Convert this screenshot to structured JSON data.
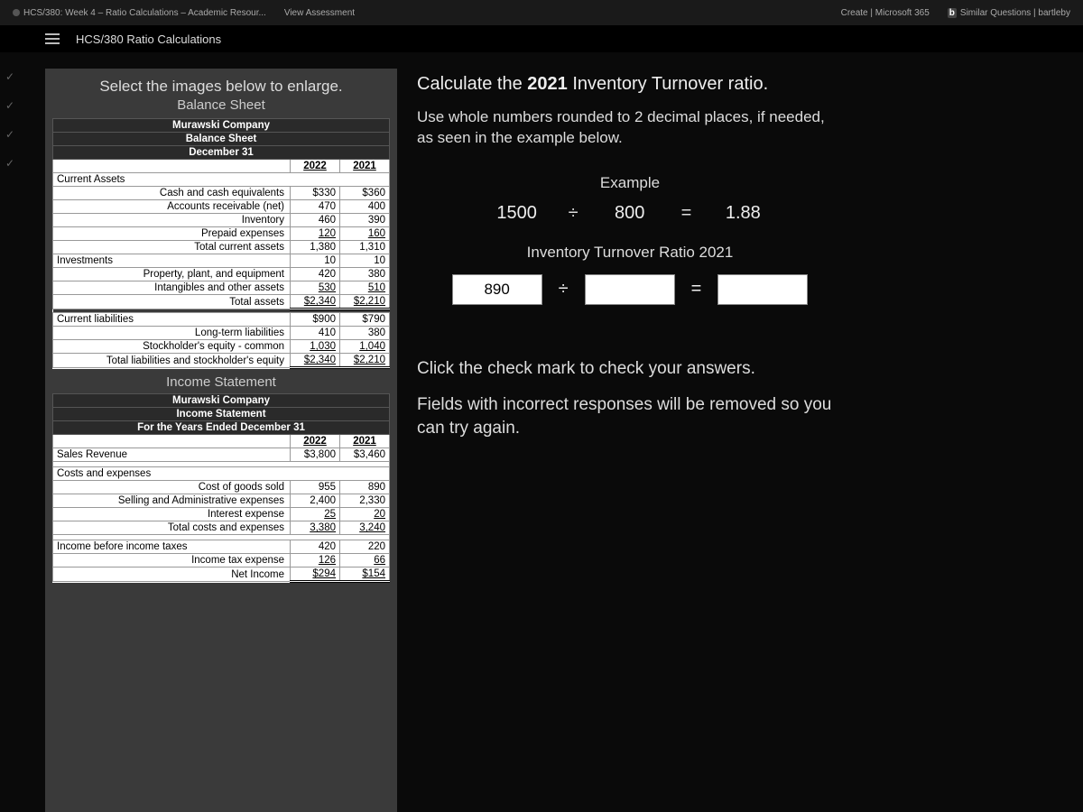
{
  "browser_tabs": {
    "t1": "HCS/380: Week 4 – Ratio Calculations – Academic Resour...",
    "t2": "View Assessment",
    "t3": "Create | Microsoft 365",
    "t4": "Similar Questions | bartleby"
  },
  "page_title": "HCS/380 Ratio Calculations",
  "left_panel": {
    "intro_line_1": "Select the images below to enlarge.",
    "balance_sheet_title": "Balance Sheet",
    "income_stmt_title": "Income Statement"
  },
  "balance_sheet": {
    "company": "Murawski Company",
    "report": "Balance Sheet",
    "asof": "December 31",
    "col_2022": "2022",
    "col_2021": "2021",
    "current_assets_label": "Current Assets",
    "rows_current": [
      {
        "label": "Cash and cash equivalents",
        "v2022": "$330",
        "v2021": "$360"
      },
      {
        "label": "Accounts receivable (net)",
        "v2022": "470",
        "v2021": "400"
      },
      {
        "label": "Inventory",
        "v2022": "460",
        "v2021": "390"
      },
      {
        "label": "Prepaid expenses",
        "v2022": "120",
        "v2021": "160",
        "u": true
      },
      {
        "label": "Total current assets",
        "v2022": "1,380",
        "v2021": "1,310"
      }
    ],
    "investments_label": "Investments",
    "investments_2022": "10",
    "investments_2021": "10",
    "rows_inv": [
      {
        "label": "Property, plant, and equipment",
        "v2022": "420",
        "v2021": "380"
      },
      {
        "label": "Intangibles and other assets",
        "v2022": "530",
        "v2021": "510",
        "u": true
      },
      {
        "label": "Total assets",
        "v2022": "$2,340",
        "v2021": "$2,210",
        "d": true
      }
    ],
    "current_liab_label": "Current liabilities",
    "current_liab_2022": "$900",
    "current_liab_2021": "$790",
    "rows_liab": [
      {
        "label": "Long-term liabilities",
        "v2022": "410",
        "v2021": "380"
      },
      {
        "label": "Stockholder's equity - common",
        "v2022": "1,030",
        "v2021": "1,040",
        "u": true
      },
      {
        "label": "Total liabilities and stockholder's equity",
        "v2022": "$2,340",
        "v2021": "$2,210",
        "d": true
      }
    ]
  },
  "income_statement": {
    "company": "Murawski Company",
    "report": "Income Statement",
    "period": "For the Years Ended December 31",
    "col_2022": "2022",
    "col_2021": "2021",
    "sales_label": "Sales Revenue",
    "sales_2022": "$3,800",
    "sales_2021": "$3,460",
    "costs_label": "Costs and expenses",
    "rows_costs": [
      {
        "label": "Cost of goods sold",
        "v2022": "955",
        "v2021": "890"
      },
      {
        "label": "Selling and Administrative expenses",
        "v2022": "2,400",
        "v2021": "2,330"
      },
      {
        "label": "Interest expense",
        "v2022": "25",
        "v2021": "20",
        "u": true
      },
      {
        "label": "Total costs and expenses",
        "v2022": "3,380",
        "v2021": "3,240",
        "u": true
      }
    ],
    "inc_before_tax_label": "Income before income taxes",
    "inc_before_tax_2022": "420",
    "inc_before_tax_2021": "220",
    "rows_tax": [
      {
        "label": "Income tax expense",
        "v2022": "126",
        "v2021": "66",
        "u": true
      },
      {
        "label": "Net Income",
        "v2022": "$294",
        "v2021": "$154",
        "d": true
      }
    ]
  },
  "question": {
    "title_pre": "Calculate the ",
    "title_bold": "2021",
    "title_post": " Inventory Turnover ratio.",
    "body": "Use whole numbers rounded to 2 decimal places, if needed, as seen in the example below.",
    "example_label": "Example",
    "example_a": "1500",
    "example_div": "÷",
    "example_b": "800",
    "example_eq": "=",
    "example_r": "1.88",
    "ratio_label": "Inventory Turnover Ratio 2021",
    "input_numerator_value": "890",
    "input_divisor_value": "",
    "input_result_value": "",
    "hint_check": "Click the check mark to check your answers.",
    "hint_fields": "Fields with incorrect responses will be removed so you can try again."
  }
}
